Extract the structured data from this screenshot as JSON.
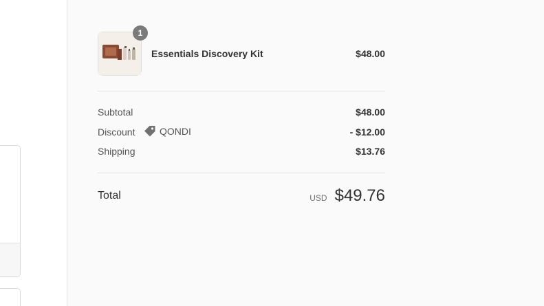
{
  "order_summary": {
    "item": {
      "quantity": "1",
      "name": "Essentials Discovery Kit",
      "price": "$48.00"
    },
    "subtotal": {
      "label": "Subtotal",
      "value": "$48.00"
    },
    "discount": {
      "label": "Discount",
      "code": "QONDI",
      "value": "- $12.00"
    },
    "shipping": {
      "label": "Shipping",
      "value": "$13.76"
    },
    "total": {
      "label": "Total",
      "currency": "USD",
      "value": "$49.76"
    }
  },
  "icons": {
    "discount": "tag-icon"
  },
  "colors": {
    "summary_background": "#fafafa",
    "badge": "#7a7a7a",
    "text": "#323232",
    "muted_text": "#545454",
    "divider": "#e1e1e1"
  }
}
